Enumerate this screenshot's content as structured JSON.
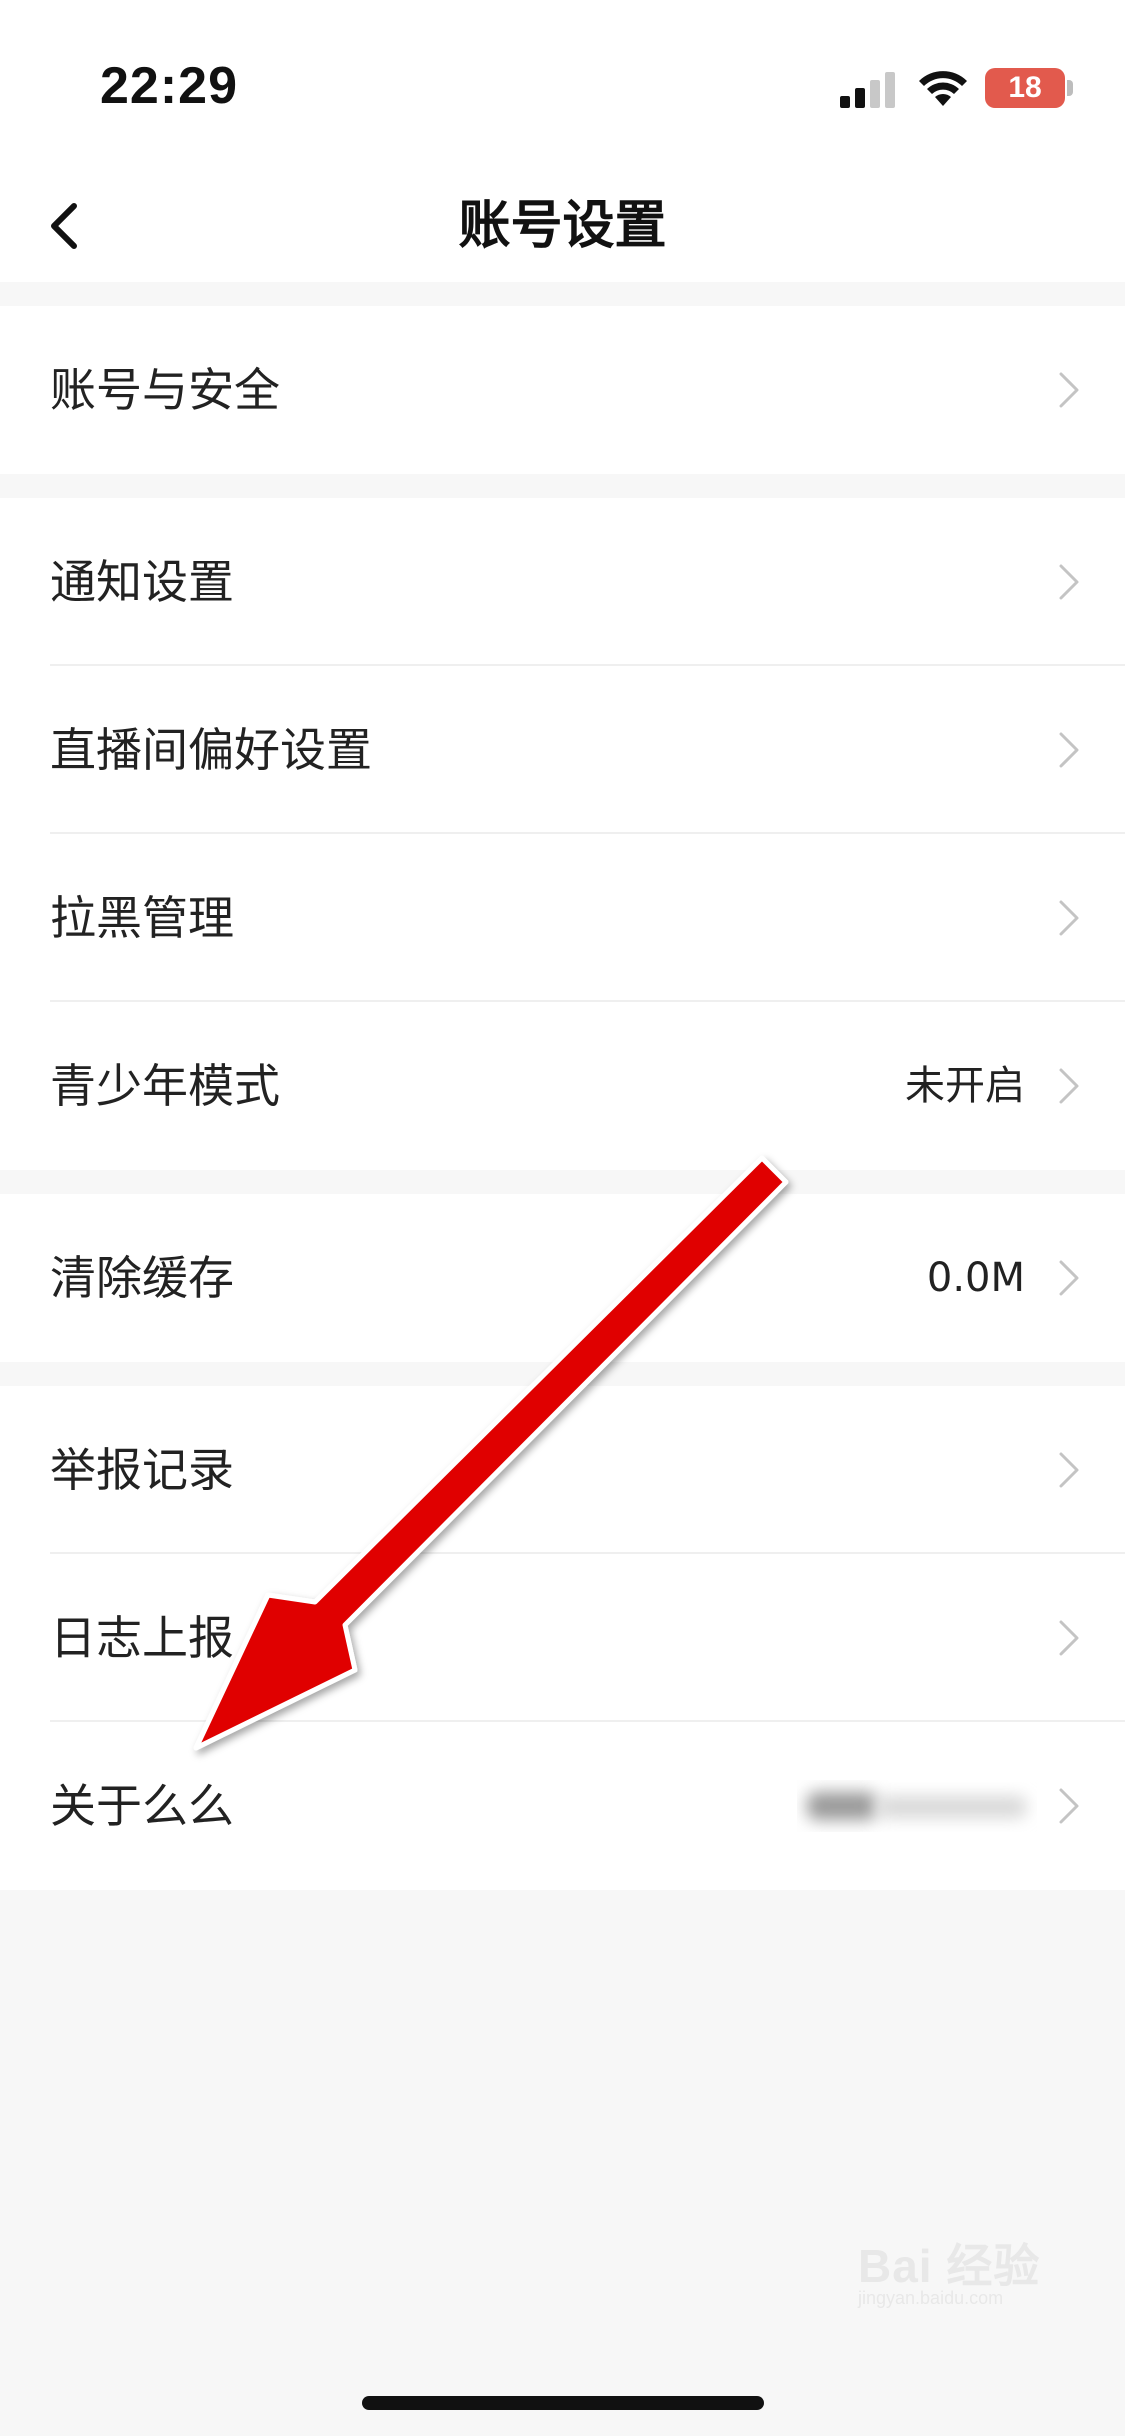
{
  "status_bar": {
    "time": "22:29",
    "battery_level": "18",
    "icons": [
      "signal-icon",
      "wifi-icon",
      "battery-icon"
    ],
    "battery_color": "#e25a4d"
  },
  "nav": {
    "title": "账号设置",
    "back_icon": "chevron-left-icon"
  },
  "groups": [
    {
      "items": [
        {
          "label": "账号与安全",
          "value": ""
        }
      ]
    },
    {
      "items": [
        {
          "label": "通知设置",
          "value": ""
        },
        {
          "label": "直播间偏好设置",
          "value": ""
        },
        {
          "label": "拉黑管理",
          "value": ""
        },
        {
          "label": "青少年模式",
          "value": "未开启"
        }
      ]
    },
    {
      "items": [
        {
          "label": "清除缓存",
          "value": "0.0M"
        }
      ]
    },
    {
      "items": [
        {
          "label": "举报记录",
          "value": ""
        },
        {
          "label": "日志上报",
          "value": ""
        },
        {
          "label": "关于么么",
          "value": ""
        }
      ]
    }
  ],
  "annotation": {
    "type": "red-arrow",
    "color": "#e00000",
    "points_to": "关于么么"
  },
  "watermark": {
    "text": "Bai 经验",
    "sub": "jingyan.baidu.com"
  },
  "colors": {
    "background": "#f7f7f7",
    "card": "#ffffff",
    "text": "#222222",
    "chevron": "#c4c4c4"
  }
}
